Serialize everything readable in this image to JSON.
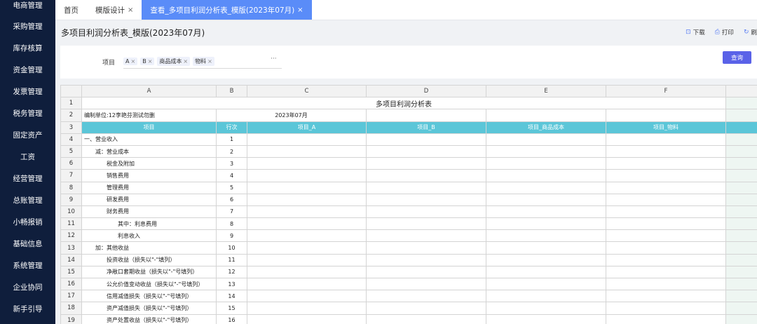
{
  "sidebar": {
    "items": [
      "电商管理",
      "采购管理",
      "库存核算",
      "资金管理",
      "发票管理",
      "税务管理",
      "固定资产",
      "工资",
      "经营管理",
      "总账管理",
      "小畅报销",
      "基础信息",
      "系统管理",
      "企业协同",
      "新手引导"
    ]
  },
  "tabs": [
    {
      "label": "首页",
      "closable": false,
      "active": false
    },
    {
      "label": "模版设计",
      "closable": true,
      "active": false
    },
    {
      "label": "查看_多项目利润分析表_模版(2023年07月)",
      "closable": true,
      "active": true
    }
  ],
  "tab_close": "×",
  "page_title": "多项目利润分析表_模版(2023年07月)",
  "actions": [
    {
      "icon": "download-icon",
      "glyph": "⊡",
      "label": "下载"
    },
    {
      "icon": "print-icon",
      "glyph": "⎙",
      "label": "打印"
    },
    {
      "icon": "refresh-icon",
      "glyph": "↻",
      "label": "刷"
    }
  ],
  "filter": {
    "label": "项目",
    "tags": [
      "A",
      "B",
      "商品成本",
      "物料"
    ],
    "tag_close": "×",
    "more": "···",
    "query_label": "查询"
  },
  "sheet": {
    "columns": [
      "A",
      "B",
      "C",
      "D",
      "E",
      "F"
    ],
    "title": "多项目利润分析表",
    "unit": "编制单位:12李艳芬测试勿删",
    "period": "2023年07月",
    "headers": [
      "项目",
      "行次",
      "项目_A",
      "项目_B",
      "项目_商品成本",
      "项目_物料"
    ],
    "row_numbers": [
      "1",
      "2",
      "3",
      "4",
      "5",
      "6",
      "7",
      "8",
      "9",
      "10",
      "11",
      "12",
      "13",
      "14",
      "15",
      "16",
      "17",
      "18",
      "19"
    ],
    "rows": [
      {
        "item": "一、营业收入",
        "indent": 0,
        "line": "1"
      },
      {
        "item": "减：营业成本",
        "indent": 1,
        "line": "2"
      },
      {
        "item": "税金及附加",
        "indent": 2,
        "line": "3"
      },
      {
        "item": "销售费用",
        "indent": 2,
        "line": "4"
      },
      {
        "item": "管理费用",
        "indent": 2,
        "line": "5"
      },
      {
        "item": "研发费用",
        "indent": 2,
        "line": "6"
      },
      {
        "item": "财务费用",
        "indent": 2,
        "line": "7"
      },
      {
        "item": "其中：利息费用",
        "indent": 3,
        "line": "8"
      },
      {
        "item": "利息收入",
        "indent": 3,
        "line": "9"
      },
      {
        "item": "加：其他收益",
        "indent": 1,
        "line": "10"
      },
      {
        "item": "投资收益（损失以\"-\"填列）",
        "indent": 2,
        "line": "11"
      },
      {
        "item": "净敞口套期收益（损失以\"-\"号填列）",
        "indent": 2,
        "line": "12"
      },
      {
        "item": "公允价值变动收益（损失以\"-\"号填列）",
        "indent": 2,
        "line": "13"
      },
      {
        "item": "信用减值损失（损失以\"-\"号填列）",
        "indent": 2,
        "line": "14"
      },
      {
        "item": "资产减值损失（损失以\"-\"号填列）",
        "indent": 2,
        "line": "15"
      },
      {
        "item": "资产处置收益（损失以\"-\"号填列）",
        "indent": 2,
        "line": "16"
      }
    ]
  },
  "colors": {
    "sidebar_bg": "#0f1e3c",
    "tab_active": "#5a8cf8",
    "header_row": "#5bc6d8",
    "query_button": "#5a62e8"
  }
}
